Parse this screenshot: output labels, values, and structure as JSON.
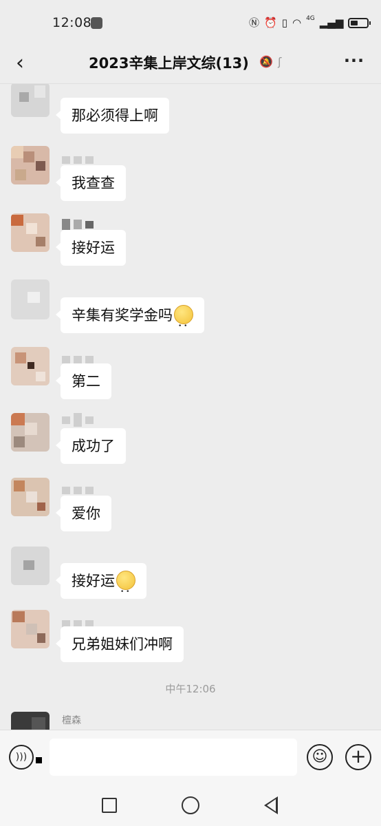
{
  "status_bar": {
    "time": "12:08",
    "icons": [
      "nfc-icon",
      "alarm-icon",
      "vibrate-icon",
      "wifi-icon",
      "signal-4g-icon",
      "battery-icon"
    ],
    "network_label": "4G"
  },
  "header": {
    "title": "2023辛集上岸文综(13)",
    "back_glyph": "‹",
    "more_glyph": "···"
  },
  "messages": [
    {
      "sender": "",
      "text": "那必须得上啊",
      "emoji": false
    },
    {
      "sender": "",
      "text": "我查查",
      "emoji": false
    },
    {
      "sender": "",
      "text": "接好运",
      "emoji": false
    },
    {
      "sender": "",
      "text": "辛集有奖学金吗",
      "emoji": true
    },
    {
      "sender": "",
      "text": "第二",
      "emoji": false
    },
    {
      "sender": "",
      "text": "成功了",
      "emoji": false
    },
    {
      "sender": "",
      "text": "爱你",
      "emoji": false
    },
    {
      "sender": "",
      "text": "接好运",
      "emoji": true
    },
    {
      "sender": "",
      "text": "兄弟姐妹们冲啊",
      "emoji": false
    }
  ],
  "time_divider": "中午12:06",
  "last_sender": "檀森",
  "input_bar": {
    "placeholder": "",
    "value": ""
  },
  "colors": {
    "background": "#ededed",
    "bubble": "#ffffff",
    "text": "#111111",
    "meta": "#9b9b9b"
  }
}
